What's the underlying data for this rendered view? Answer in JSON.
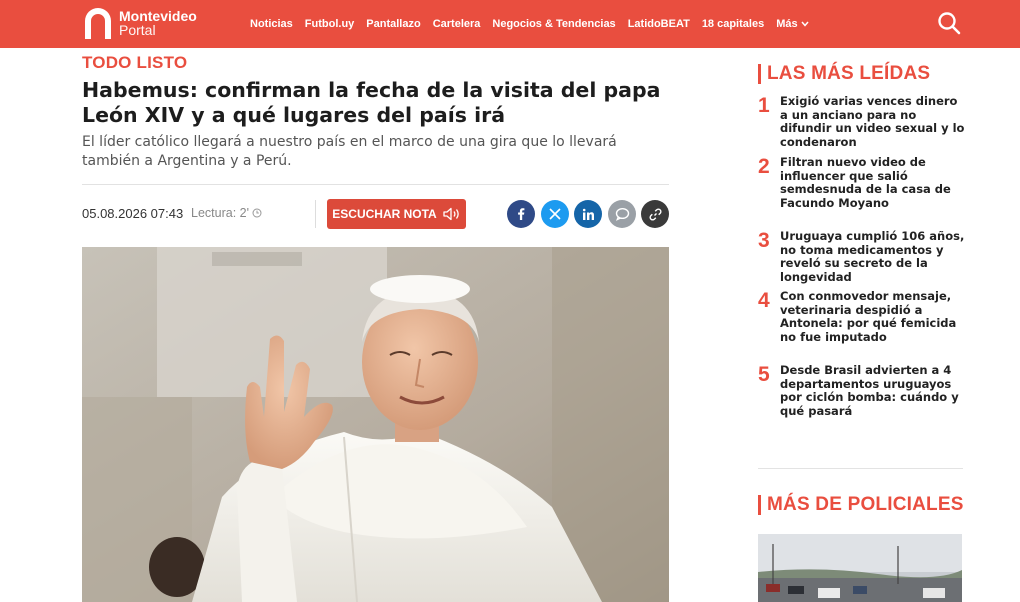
{
  "header": {
    "logo_line1": "Montevideo",
    "logo_line2": "Portal",
    "nav": [
      "Noticias",
      "Futbol.uy",
      "Pantallazo",
      "Cartelera",
      "Negocios & Tendencias",
      "LatidoBEAT",
      "18 capitales"
    ],
    "more_label": "Más",
    "search_icon": "search-icon",
    "brand_color": "#e94e3f"
  },
  "article": {
    "kicker": "TODO LISTO",
    "headline": "Habemus: confirman la fecha de la visita del papa León XIV y a qué lugares del país irá",
    "subhead": "El líder católico llegará a nuestro país en el marco de una gira que lo llevará también a Argentina y a Perú.",
    "date": "05.08.2026 07:43",
    "reading": "Lectura: 2'",
    "listen_label": "ESCUCHAR NOTA",
    "share_icons": [
      "facebook-icon",
      "x-icon",
      "linkedin-icon",
      "comment-icon",
      "link-icon"
    ]
  },
  "sidebar": {
    "most_read_title": "LAS MÁS LEÍDAS",
    "most_read": [
      {
        "num": "1",
        "text": "Exigió varias vences dinero a un anciano para no difundir un video sexual y lo condenaron"
      },
      {
        "num": "2",
        "text": "Filtran nuevo video de influencer que salió semdesnuda de la casa de Facundo Moyano"
      },
      {
        "num": "3",
        "text": "Uruguaya cumplió 106 años, no toma medicamentos y reveló su secreto de la longevidad"
      },
      {
        "num": "4",
        "text": "Con conmovedor mensaje, veterinaria despidió a Antonela: por qué femicida no fue imputado"
      },
      {
        "num": "5",
        "text": "Desde Brasil advierten a 4 departamentos uruguayos por ciclón bomba: cuándo y qué pasará"
      }
    ],
    "more_section_title": "MÁS DE POLICIALES"
  }
}
